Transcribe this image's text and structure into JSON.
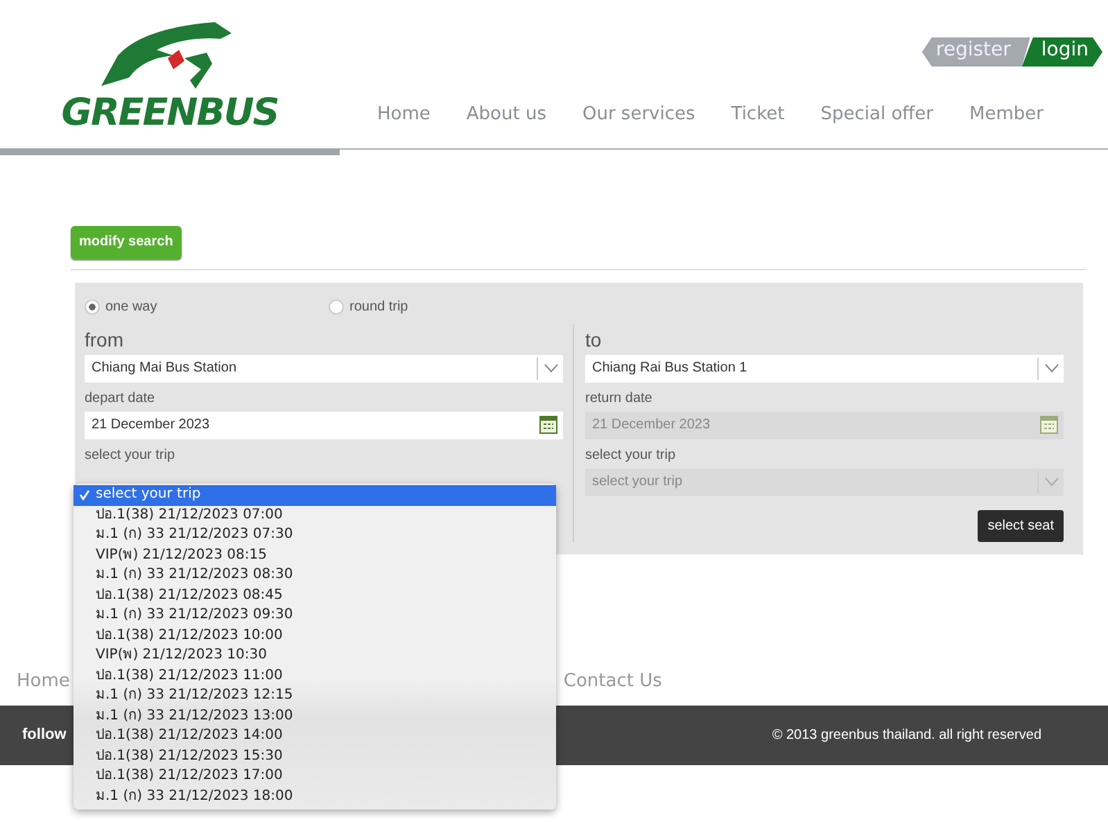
{
  "header": {
    "logo_text": "GREENBUS",
    "account_links": [
      {
        "kind": "register",
        "label": "register"
      },
      {
        "kind": "login",
        "label": "login"
      }
    ],
    "nav": [
      "Home",
      "About us",
      "Our services",
      "Ticket",
      "Special offer",
      "Member"
    ]
  },
  "modify_button": "modify search",
  "search_form": {
    "trip_types": [
      {
        "label": "one way",
        "selected": true
      },
      {
        "label": "round trip",
        "selected": false
      }
    ],
    "from": {
      "heading": "from",
      "station": "Chiang Mai Bus Station",
      "date_label": "depart date",
      "date": "21 December 2023",
      "trip_label": "select your trip",
      "disabled": false
    },
    "to": {
      "heading": "to",
      "station": "Chiang Rai Bus Station 1",
      "date_label": "return date",
      "date": "21 December 2023",
      "trip_label": "select your trip",
      "trip_placeholder": "select your trip",
      "disabled": true
    },
    "submit": "select seat"
  },
  "trip_dropdown": {
    "options": [
      {
        "label": "select your trip",
        "selected": true
      },
      {
        "label": "ปอ.1(38) 21/12/2023 07:00",
        "selected": false
      },
      {
        "label": "ม.1 (ก) 33 21/12/2023 07:30",
        "selected": false
      },
      {
        "label": "VIP(พ) 21/12/2023 08:15",
        "selected": false
      },
      {
        "label": "ม.1 (ก) 33 21/12/2023 08:30",
        "selected": false
      },
      {
        "label": "ปอ.1(38) 21/12/2023 08:45",
        "selected": false
      },
      {
        "label": "ม.1 (ก) 33 21/12/2023 09:30",
        "selected": false
      },
      {
        "label": "ปอ.1(38) 21/12/2023 10:00",
        "selected": false
      },
      {
        "label": "VIP(พ) 21/12/2023 10:30",
        "selected": false
      },
      {
        "label": "ปอ.1(38) 21/12/2023 11:00",
        "selected": false
      },
      {
        "label": "ม.1 (ก) 33 21/12/2023 12:15",
        "selected": false
      },
      {
        "label": "ม.1 (ก) 33 21/12/2023 13:00",
        "selected": false
      },
      {
        "label": "ปอ.1(38) 21/12/2023 14:00",
        "selected": false
      },
      {
        "label": "ปอ.1(38) 21/12/2023 15:30",
        "selected": false
      },
      {
        "label": "ปอ.1(38) 21/12/2023 17:00",
        "selected": false
      },
      {
        "label": "ม.1 (ก) 33 21/12/2023 18:00",
        "selected": false
      }
    ]
  },
  "footer": {
    "links": [
      "Home",
      "Contact Us"
    ],
    "follow": "follow",
    "copyright": "© 2013 greenbus thailand. all right reserved"
  }
}
